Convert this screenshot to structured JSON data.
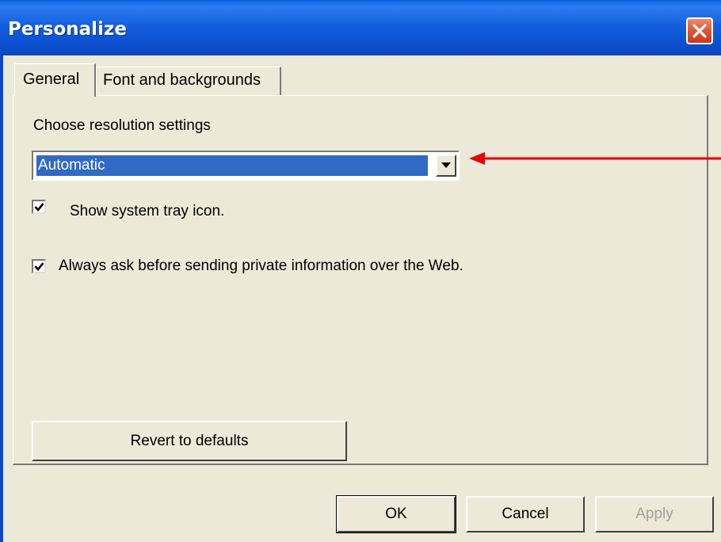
{
  "window": {
    "title": "Personalize"
  },
  "tabs": [
    {
      "label": "General",
      "selected": true
    },
    {
      "label": "Font and backgrounds",
      "selected": false
    }
  ],
  "general": {
    "resolution_label": "Choose resolution settings",
    "resolution_value": "Automatic",
    "checkboxes": [
      {
        "label": "Show system tray icon.",
        "checked": true
      },
      {
        "label": "Always ask before sending private information over the Web.",
        "checked": true
      }
    ],
    "revert_label": "Revert to defaults"
  },
  "footer": {
    "ok_label": "OK",
    "cancel_label": "Cancel",
    "apply_label": "Apply"
  },
  "colors": {
    "titlebar": "#0a5fdc",
    "selection": "#316ac5",
    "annotation_arrow": "#e8000b",
    "face": "#ece9d8"
  }
}
